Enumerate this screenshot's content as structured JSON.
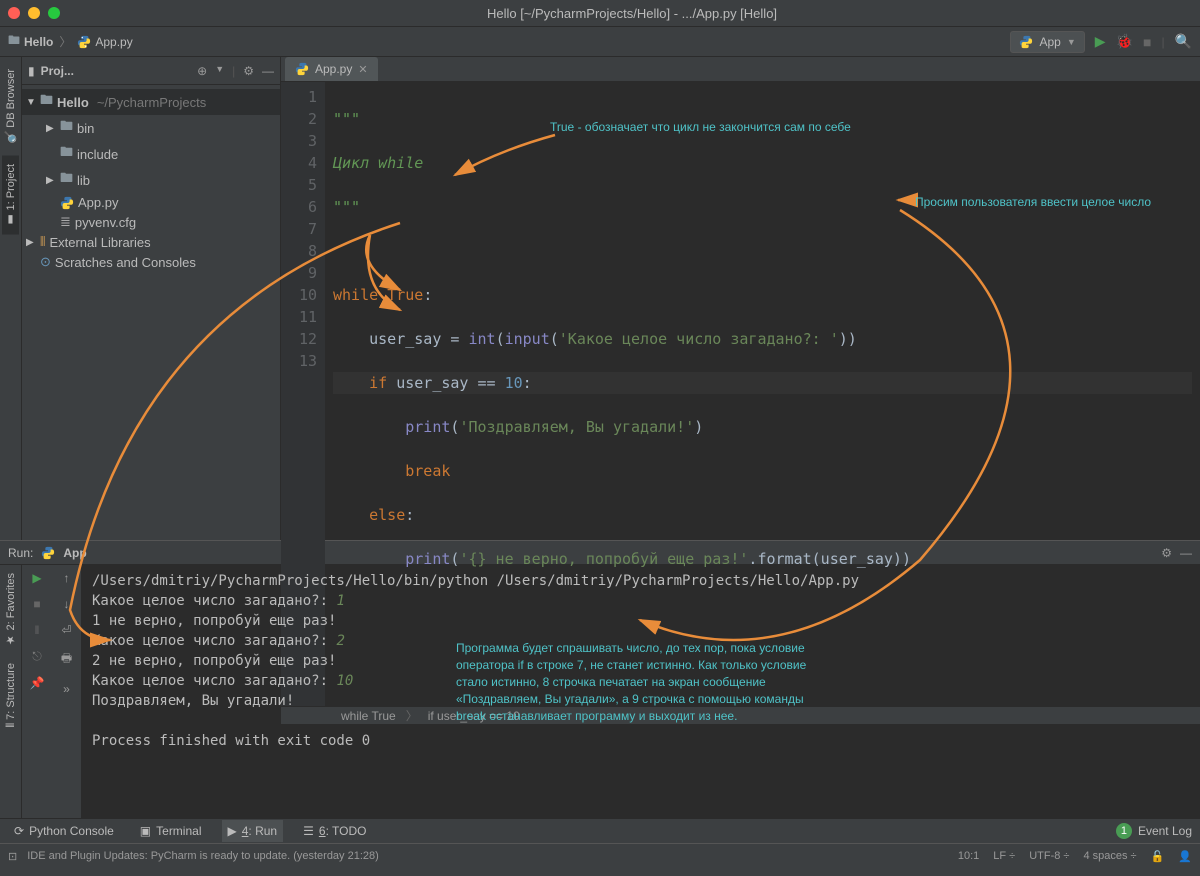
{
  "window_title": "Hello [~/PycharmProjects/Hello] - .../App.py [Hello]",
  "breadcrumb": {
    "project": "Hello",
    "file": "App.py"
  },
  "run_config_label": "App",
  "project_panel": {
    "title": "Proj...",
    "tree": {
      "root_name": "Hello",
      "root_path": "~/PycharmProjects",
      "bin": "bin",
      "include": "include",
      "lib": "lib",
      "app_py": "App.py",
      "pyvenv": "pyvenv.cfg",
      "external": "External Libraries",
      "scratches": "Scratches and Consoles"
    }
  },
  "left_tabs": {
    "db": "DB Browser",
    "project": "1: Project",
    "favorites": "2: Favorites",
    "structure": "7: Structure"
  },
  "editor_tab": "App.py",
  "code": {
    "l1": "\"\"\"",
    "l2": "Цикл while",
    "l3": "\"\"\"",
    "l5_while": "while ",
    "l5_true": "True",
    "l5_colon": ":",
    "l6a": "    user_say = ",
    "l6b": "int",
    "l6c": "(",
    "l6d": "input",
    "l6e": "(",
    "l6f": "'Какое целое число загадано?: '",
    "l6g": "))",
    "l7a": "    ",
    "l7_if": "if",
    "l7b": " user_say == ",
    "l7_10": "10",
    "l7c": ":",
    "l8a": "        ",
    "l8_print": "print",
    "l8b": "(",
    "l8_str": "'Поздравляем, Вы угадали!'",
    "l8c": ")",
    "l9a": "        ",
    "l9_break": "break",
    "l10a": "    ",
    "l10_else": "else",
    "l10b": ":",
    "l11a": "        ",
    "l11_print": "print",
    "l11b": "(",
    "l11_str": "'{} не верно, попробуй еще раз!'",
    "l11c": ".format(user_say))"
  },
  "line_numbers": [
    "1",
    "2",
    "3",
    "4",
    "5",
    "6",
    "7",
    "8",
    "9",
    "10",
    "11",
    "12",
    "13"
  ],
  "editor_breadcrumb": {
    "a": "while True",
    "b": "if user_say == 10"
  },
  "run": {
    "title": "Run:",
    "app": "App",
    "cmd": "/Users/dmitriy/PycharmProjects/Hello/bin/python /Users/dmitriy/PycharmProjects/Hello/App.py",
    "q": "Какое целое число загадано?: ",
    "i1": "1",
    "r1": "1 не верно, попробуй еще раз!",
    "i2": "2",
    "r2": "2 не верно, попробуй еще раз!",
    "i3": "10",
    "r3": "Поздравляем, Вы угадали!",
    "exit": "Process finished with exit code 0"
  },
  "annotations": {
    "a1": "True - обозначает что цикл не закончится сам по себе",
    "a2": "Просим пользователя ввести целое число",
    "a3": "Программа будет спрашивать число, до тех пор, пока условие оператора if в строке 7, не станет истинно. Как только условие стало истинно, 8 строчка печатает на экран сообщение «Поздравляем, Вы угадали», а 9 строчка с помощью команды break останавливает программу и выходит из нее."
  },
  "bottom_tabs": {
    "console": "Python Console",
    "terminal": "Terminal",
    "run": "4: Run",
    "todo": "6: TODO",
    "eventlog": "Event Log",
    "badge": "1"
  },
  "status": {
    "msg": "IDE and Plugin Updates: PyCharm is ready to update. (yesterday 21:28)",
    "pos": "10:1",
    "le": "LF",
    "enc": "UTF-8",
    "indent": "4 spaces"
  }
}
